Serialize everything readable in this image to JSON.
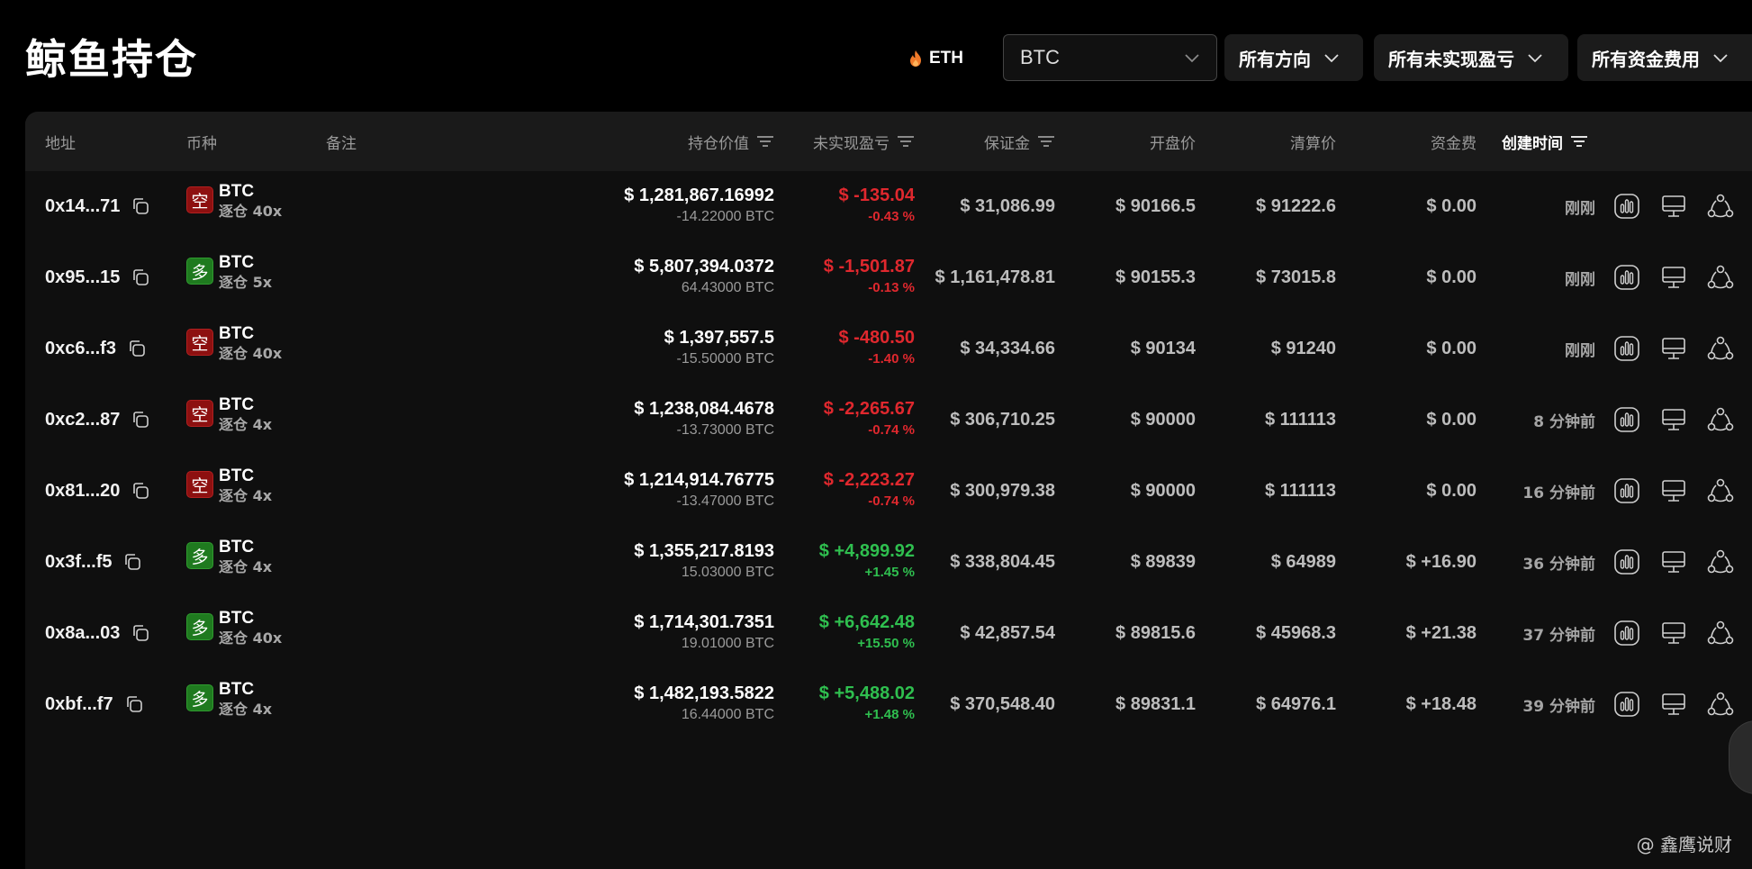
{
  "title": "鲸鱼持仓",
  "filters": {
    "eth_label": "ETH",
    "coin_value": "BTC",
    "direction_label": "所有方向",
    "pnl_label": "所有未实现盈亏",
    "funding_label": "所有资金费用"
  },
  "columns": {
    "address": "地址",
    "coin": "币种",
    "note": "备注",
    "position_value": "持仓价值",
    "unrealized_pnl": "未实现盈亏",
    "margin": "保证金",
    "entry_price": "开盘价",
    "liq_price": "清算价",
    "funding": "资金费",
    "created": "创建时间"
  },
  "rows": [
    {
      "address": "0x14...71",
      "side": "空",
      "side_type": "short",
      "coin": "BTC",
      "mode": "逐仓 40x",
      "value": "$ 1,281,867.16992",
      "size": "-14.22000 BTC",
      "pnl": "$ -135.04",
      "pnl_pct": "-0.43 %",
      "pnl_sign": "neg",
      "margin": "$ 31,086.99",
      "entry": "$ 90166.5",
      "liq": "$ 91222.6",
      "funding": "$ 0.00",
      "funding_sign": "zero",
      "time": "刚刚"
    },
    {
      "address": "0x95...15",
      "side": "多",
      "side_type": "long",
      "coin": "BTC",
      "mode": "逐仓 5x",
      "value": "$ 5,807,394.0372",
      "size": "64.43000 BTC",
      "pnl": "$ -1,501.87",
      "pnl_pct": "-0.13 %",
      "pnl_sign": "neg",
      "margin": "$ 1,161,478.81",
      "entry": "$ 90155.3",
      "liq": "$ 73015.8",
      "funding": "$ 0.00",
      "funding_sign": "zero",
      "time": "刚刚"
    },
    {
      "address": "0xc6...f3",
      "side": "空",
      "side_type": "short",
      "coin": "BTC",
      "mode": "逐仓 40x",
      "value": "$ 1,397,557.5",
      "size": "-15.50000 BTC",
      "pnl": "$ -480.50",
      "pnl_pct": "-1.40 %",
      "pnl_sign": "neg",
      "margin": "$ 34,334.66",
      "entry": "$ 90134",
      "liq": "$ 91240",
      "funding": "$ 0.00",
      "funding_sign": "zero",
      "time": "刚刚"
    },
    {
      "address": "0xc2...87",
      "side": "空",
      "side_type": "short",
      "coin": "BTC",
      "mode": "逐仓 4x",
      "value": "$ 1,238,084.4678",
      "size": "-13.73000 BTC",
      "pnl": "$ -2,265.67",
      "pnl_pct": "-0.74 %",
      "pnl_sign": "neg",
      "margin": "$ 306,710.25",
      "entry": "$ 90000",
      "liq": "$ 111113",
      "funding": "$ 0.00",
      "funding_sign": "zero",
      "time": "8 分钟前"
    },
    {
      "address": "0x81...20",
      "side": "空",
      "side_type": "short",
      "coin": "BTC",
      "mode": "逐仓 4x",
      "value": "$ 1,214,914.76775",
      "size": "-13.47000 BTC",
      "pnl": "$ -2,223.27",
      "pnl_pct": "-0.74 %",
      "pnl_sign": "neg",
      "margin": "$ 300,979.38",
      "entry": "$ 90000",
      "liq": "$ 111113",
      "funding": "$ 0.00",
      "funding_sign": "zero",
      "time": "16 分钟前"
    },
    {
      "address": "0x3f...f5",
      "side": "多",
      "side_type": "long",
      "coin": "BTC",
      "mode": "逐仓 4x",
      "value": "$ 1,355,217.8193",
      "size": "15.03000 BTC",
      "pnl": "$ +4,899.92",
      "pnl_pct": "+1.45 %",
      "pnl_sign": "pos",
      "margin": "$ 338,804.45",
      "entry": "$ 89839",
      "liq": "$ 64989",
      "funding": "$ +16.90",
      "funding_sign": "pos",
      "time": "36 分钟前"
    },
    {
      "address": "0x8a...03",
      "side": "多",
      "side_type": "long",
      "coin": "BTC",
      "mode": "逐仓 40x",
      "value": "$ 1,714,301.7351",
      "size": "19.01000 BTC",
      "pnl": "$ +6,642.48",
      "pnl_pct": "+15.50 %",
      "pnl_sign": "pos",
      "margin": "$ 42,857.54",
      "entry": "$ 89815.6",
      "liq": "$ 45968.3",
      "funding": "$ +21.38",
      "funding_sign": "pos",
      "time": "37 分钟前"
    },
    {
      "address": "0xbf...f7",
      "side": "多",
      "side_type": "long",
      "coin": "BTC",
      "mode": "逐仓 4x",
      "value": "$ 1,482,193.5822",
      "size": "16.44000 BTC",
      "pnl": "$ +5,488.02",
      "pnl_pct": "+1.48 %",
      "pnl_sign": "pos",
      "margin": "$ 370,548.40",
      "entry": "$ 89831.1",
      "liq": "$ 64976.1",
      "funding": "$ +18.48",
      "funding_sign": "pos",
      "time": "39 分钟前"
    }
  ],
  "watermark": "@ 鑫鹰说财",
  "colors": {
    "negative": "#e0282e",
    "positive": "#2fbf4f",
    "short_badge": "#8d1010",
    "long_badge": "#1f7a1f"
  }
}
